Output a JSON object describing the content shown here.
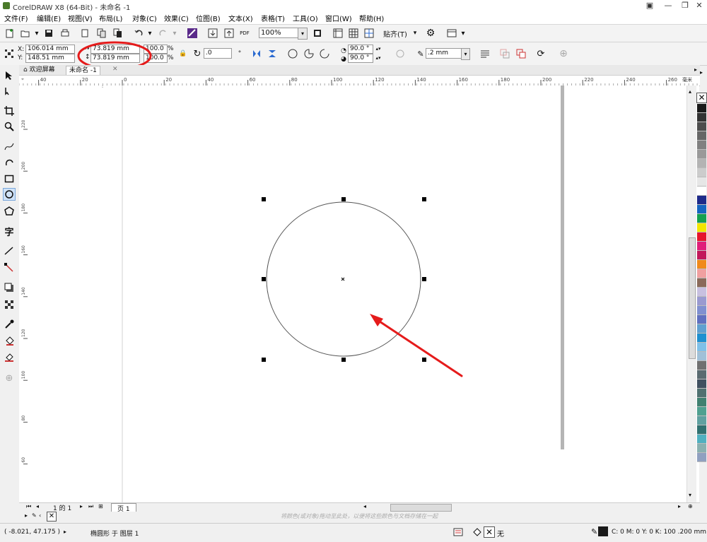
{
  "app": {
    "title": "CorelDRAW X8 (64-Bit) - 未命名 -1",
    "window_controls": [
      "minimize",
      "restore",
      "close"
    ]
  },
  "menu": {
    "items": [
      "文件(F)",
      "编辑(E)",
      "视图(V)",
      "布局(L)",
      "对象(C)",
      "效果(C)",
      "位图(B)",
      "文本(X)",
      "表格(T)",
      "工具(O)",
      "窗口(W)",
      "帮助(H)"
    ]
  },
  "toolbar": {
    "zoom_value": "100%",
    "snap_label": "贴齐(T)",
    "pdf_label": "PDF"
  },
  "property_bar": {
    "x_label": "X:",
    "x_value": "106.014 mm",
    "y_label": "Y:",
    "y_value": "148.51 mm",
    "width_value": "73.819 mm",
    "height_value": "73.819 mm",
    "scale_x": "100.0",
    "scale_y": "100.0",
    "percent": "%",
    "rotation": ".0",
    "angle_start": "90.0 °",
    "angle_end": "90.0 °",
    "outline_width": ".2 mm"
  },
  "tabs": {
    "welcome": "欢迎屏幕",
    "document": "未命名 -1"
  },
  "rulers": {
    "h_ticks": [
      "40",
      "20",
      "0",
      "20",
      "40",
      "60",
      "80",
      "100",
      "120",
      "140",
      "160",
      "180",
      "200",
      "220",
      "240",
      "260"
    ],
    "h_unit": "毫米",
    "v_ticks": [
      "220",
      "200",
      "180",
      "160",
      "140",
      "120",
      "100",
      "80",
      "60"
    ]
  },
  "page_nav": {
    "page_count": "1 的 1",
    "page_tab": "页 1"
  },
  "palette_hint": "将颜色(或对象)拖动至此处，以便将这些颜色与文档存储在一起",
  "status": {
    "coords": "( -8.021, 47.175 )",
    "object_info": "椭圆形 于 图层 1",
    "fill_none": "无",
    "color_spec": "C: 0 M: 0 Y: 0 K: 100  .200 mm"
  },
  "colors": {
    "annotation_red": "#e51b1b",
    "palette": [
      "#1a1a1a",
      "#333333",
      "#4d4d4d",
      "#666666",
      "#808080",
      "#999999",
      "#b3b3b3",
      "#cccccc",
      "#e6e6e6",
      "#ffffff",
      "#1e2a8a",
      "#1565c0",
      "#15a050",
      "#f2e600",
      "#e6142d",
      "#e01e7a",
      "#c2185b",
      "#f08a1a",
      "#f0a0a0",
      "#8a6a5a",
      "#c8c0e0",
      "#9a9ad0",
      "#8090d0",
      "#6070c0",
      "#60a0d0",
      "#2090d0",
      "#80c0e8",
      "#a0c0d8",
      "#707070",
      "#5a6a70",
      "#405060",
      "#507070",
      "#408070",
      "#50a090",
      "#60a0a0",
      "#307070",
      "#50b0c0",
      "#8ab0b0",
      "#90a0c0"
    ]
  }
}
